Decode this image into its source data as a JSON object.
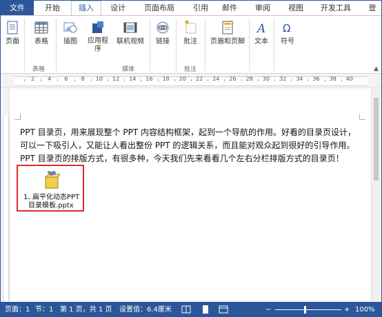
{
  "tabs": [
    {
      "label": "文件"
    },
    {
      "label": "开始"
    },
    {
      "label": "插入"
    },
    {
      "label": "设计"
    },
    {
      "label": "页面布局"
    },
    {
      "label": "引用"
    },
    {
      "label": "邮件"
    },
    {
      "label": "审阅"
    },
    {
      "label": "视图"
    },
    {
      "label": "开发工具"
    },
    {
      "label": "登"
    }
  ],
  "ribbon": {
    "page_btn": "页面",
    "table_btn": "表格",
    "illustration_btn": "插图",
    "apps_btn_line1": "应用程",
    "apps_btn_line2": "序",
    "online_video_btn": "联机视频",
    "link_btn": "链接",
    "comment_btn": "批注",
    "header_footer_btn": "页眉和页脚",
    "text_btn": "文本",
    "symbol_btn": "符号",
    "group_table": "表格",
    "group_media": "媒体",
    "group_comment": "批注"
  },
  "ruler": {
    "numbers": [
      "2",
      "4",
      "6",
      "8",
      "10",
      "12",
      "14",
      "16",
      "18",
      "20",
      "22",
      "24",
      "26",
      "28",
      "30",
      "32",
      "34",
      "36",
      "38",
      "40"
    ]
  },
  "document": {
    "line1": "PPT 目录页，用来展现整个 PPT 内容结构框架，起到一个导航的作用。好看的目录页设计，",
    "line2": "可以一下吸引人，又能让人看出整份 PPT 的逻辑关系，而且能对观众起到很好的引导作用。",
    "line3": "PPT 目录页的排版方式，有很多种，今天我们先来看看几个左右分栏排版方式的目录页！",
    "embed_number": "1、",
    "embed_name_line1": "扁平化动态PPT",
    "embed_name_line2": "目录模板.pptx"
  },
  "status": {
    "page": "页面：1",
    "section": "节：1",
    "page_of": "第 1 页，共 1 页",
    "setting": "设置值：6.4厘米",
    "zoom": "100%",
    "zoom_level": 1.0
  },
  "colors": {
    "accent": "#2b579a",
    "highlight_box": "#e02a2a"
  }
}
